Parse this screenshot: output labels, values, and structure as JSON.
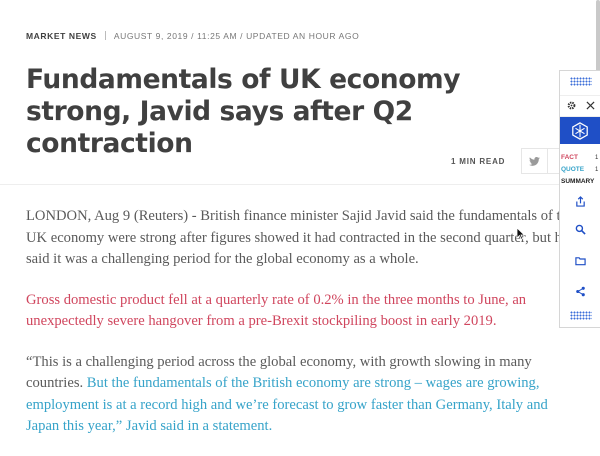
{
  "meta": {
    "category": "MARKET NEWS",
    "dateline": "AUGUST 9, 2019 / 11:25 AM / UPDATED AN HOUR AGO"
  },
  "headline": "Fundamentals of UK economy strong, Javid says after Q2 contraction",
  "share": {
    "read_time": "1 MIN READ",
    "icons": [
      "twitter-icon"
    ]
  },
  "article": {
    "p1_lines": [
      "LONDON, Aug 9 (Reuters) - British finance minister Sajid Javid said the fundamentals of the",
      "UK economy were strong after figures showed it had contracted in the second quarter, but he",
      "said it was a challenging period for the global economy as a whole."
    ],
    "p2_lines": [
      "Gross domestic product fell at a quarterly rate of 0.2% in the three months to June, an",
      "unexpectedly severe hangover from a pre-Brexit stockpiling boost in early 2019."
    ],
    "p3_plain": "“This is a challenging period across the global economy, with growth slowing in many",
    "p3_mixed_plain": "countries. ",
    "p3_mixed_blue": "But the fundamentals of the British economy are strong – wages are growing,",
    "p3_blue_lines": [
      "employment is at a record high and we’re forecast to grow faster than Germany, Italy and",
      "Japan this year,” Javid said in a statement."
    ]
  },
  "panel": {
    "fact_label": "FACT",
    "fact_count": "1",
    "quote_label": "QUOTE",
    "quote_count": "1",
    "summary_label": "SUMMARY",
    "colors": {
      "fact": "#d0465e",
      "quote": "#36a3c9",
      "accent": "#1f4fc6"
    },
    "icons": [
      "gear-icon",
      "close-icon",
      "logo-icon",
      "share-out-icon",
      "search-icon",
      "folder-icon",
      "share-icon"
    ]
  }
}
